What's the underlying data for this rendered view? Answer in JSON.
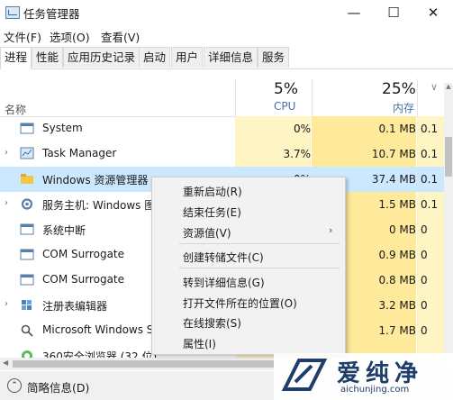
{
  "window": {
    "title": "任务管理器",
    "controls": {
      "minimize": "—",
      "maximize": "☐",
      "close": "✕"
    }
  },
  "menubar": [
    "文件(F)",
    "选项(O)",
    "查看(V)"
  ],
  "tabs": [
    "进程",
    "性能",
    "应用历史记录",
    "启动",
    "用户",
    "详细信息",
    "服务"
  ],
  "active_tab": "进程",
  "columns": {
    "name": "名称",
    "cpu": {
      "pct": "5%",
      "label": "CPU"
    },
    "memory": {
      "pct": "25%",
      "label": "内存"
    }
  },
  "processes": [
    {
      "name": "System",
      "cpu": "0%",
      "memory": "0.1 MB",
      "disk": "0.1",
      "expandable": false,
      "icon": "system-window-icon"
    },
    {
      "name": "Task Manager",
      "cpu": "3.7%",
      "memory": "10.7 MB",
      "disk": "0.1",
      "expandable": true,
      "icon": "task-manager-icon"
    },
    {
      "name": "Windows 资源管理器",
      "cpu": "0%",
      "memory": "37.4 MB",
      "disk": "0.1",
      "expandable": false,
      "icon": "explorer-folder-icon",
      "selected": true
    },
    {
      "name": "服务主机: Windows 图",
      "cpu": "",
      "memory": "1.5 MB",
      "disk": "0.1",
      "expandable": true,
      "icon": "gear-icon"
    },
    {
      "name": "系统中断",
      "cpu": "",
      "memory": "0 MB",
      "disk": "0",
      "expandable": false,
      "icon": "system-window-icon"
    },
    {
      "name": "COM Surrogate",
      "cpu": "",
      "memory": "0.9 MB",
      "disk": "0",
      "expandable": false,
      "icon": "system-window-icon"
    },
    {
      "name": "COM Surrogate",
      "cpu": "",
      "memory": "0.8 MB",
      "disk": "0",
      "expandable": false,
      "icon": "system-window-icon"
    },
    {
      "name": "注册表编辑器",
      "cpu": "",
      "memory": "3.2 MB",
      "disk": "0",
      "expandable": true,
      "icon": "registry-icon"
    },
    {
      "name": "Microsoft Windows S",
      "cpu": "",
      "memory": "1.7 MB",
      "disk": "0",
      "expandable": false,
      "icon": "search-icon"
    },
    {
      "name": "360安全浏览器 (32 位)",
      "cpu": "",
      "memory": "",
      "disk": "",
      "expandable": false,
      "icon": "browser-icon"
    }
  ],
  "context_menu": {
    "items": [
      {
        "label": "重新启动(R)"
      },
      {
        "label": "结束任务(E)"
      },
      {
        "label": "资源值(V)",
        "submenu_arrow": "›"
      },
      {
        "label": "创建转储文件(C)"
      },
      {
        "label": "转到详细信息(G)"
      },
      {
        "label": "打开文件所在的位置(O)"
      },
      {
        "label": "在线搜索(S)"
      },
      {
        "label": "属性(I)"
      }
    ]
  },
  "footer": {
    "label": "简略信息(D)",
    "icon": "chevron-up-circle-icon"
  },
  "watermark": {
    "brand": "爱纯净",
    "url": "aichunjing.com"
  },
  "colors": {
    "cpu_fill": "#fff4c4",
    "mem_fill": "#ffe99b",
    "selected_row": "#cce8ff",
    "header_label": "#4a6fa5"
  }
}
